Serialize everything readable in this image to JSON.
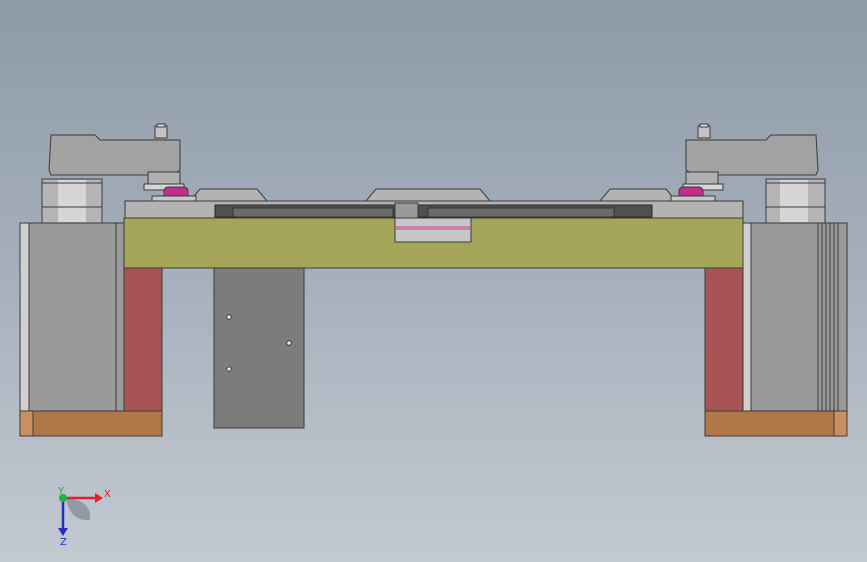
{
  "triad": {
    "x_label": "X",
    "y_label": "Y",
    "z_label": "Z",
    "x_color": "#e0202a",
    "y_color": "#20b040",
    "z_color": "#2030c0"
  },
  "colors": {
    "background_top": "#8e9aa8",
    "background_bottom": "#c3c9d1",
    "plate": "#a5a55a",
    "steel": "#8f8f8f",
    "steel_light": "#b9b9b9",
    "dark_steel": "#5a5a5a",
    "red_block": "#a85454",
    "wood_base": "#b07848",
    "pin": "#c0308a"
  },
  "icons": {
    "view_orientation": "coordinate-triad-icon"
  }
}
